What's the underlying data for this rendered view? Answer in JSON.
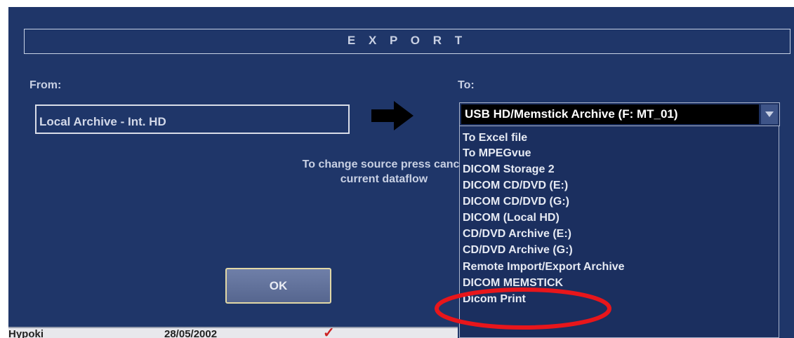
{
  "dialog": {
    "title": "E X P O R T",
    "from_label": "From:",
    "to_label": "To:",
    "from_value": "Local Archive - Int. HD",
    "help_line1": "To change source press cance",
    "help_line2": "current dataflow",
    "ok_label": "OK"
  },
  "destination_select": {
    "selected_value": "USB HD/Memstick Archive (F: MT_01)",
    "options": [
      "To Excel file",
      "To MPEGvue",
      "DICOM Storage 2",
      "DICOM CD/DVD (E:)",
      "DICOM CD/DVD (G:)",
      "DICOM (Local HD)",
      "CD/DVD Archive (E:)",
      "CD/DVD Archive (G:)",
      "Remote Import/Export Archive",
      "DICOM MEMSTICK",
      "Dicom Print"
    ],
    "highlighted_option": "DICOM MEMSTICK"
  },
  "status_row": {
    "name": "Hypoki",
    "date": "28/05/2002"
  },
  "colors": {
    "dialog_background": "#1f3669",
    "text": "#c8d0e3",
    "highlight_ellipse": "#e8161b",
    "ok_border": "#e2d8a6"
  },
  "icons": {
    "arrow": "right-arrow-icon",
    "dropdown": "chevron-down-icon"
  }
}
